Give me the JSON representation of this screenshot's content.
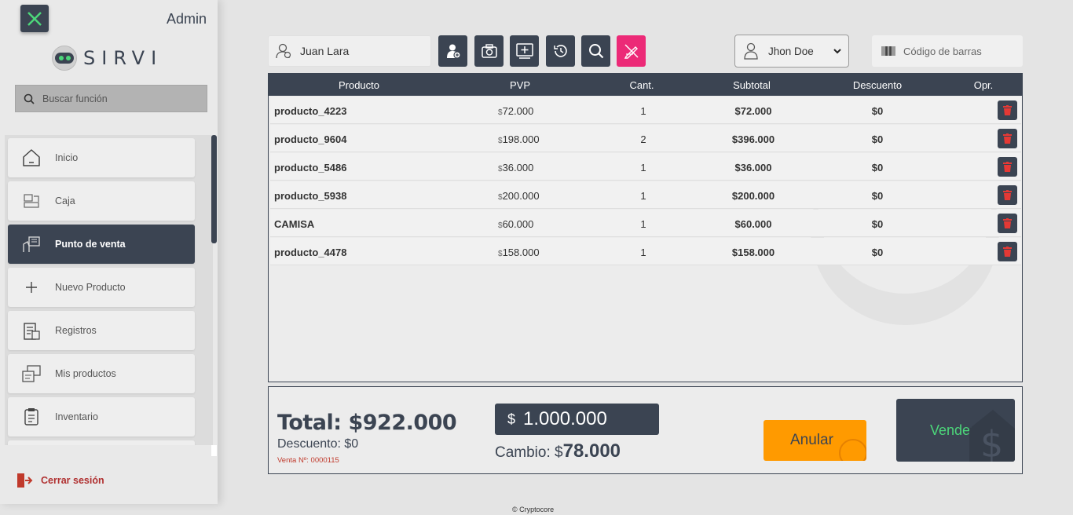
{
  "sidebar": {
    "admin_label": "Admin",
    "logo_text": "SIRVI",
    "search_placeholder": "Buscar función",
    "items": [
      {
        "label": "Inicio",
        "icon": "home-icon"
      },
      {
        "label": "Caja",
        "icon": "cash-register-icon"
      },
      {
        "label": "Punto de venta",
        "icon": "point-of-sale-icon",
        "active": true
      },
      {
        "label": "Nuevo Producto",
        "icon": "plus-icon"
      },
      {
        "label": "Registros",
        "icon": "records-icon"
      },
      {
        "label": "Mis productos",
        "icon": "products-icon"
      },
      {
        "label": "Inventario",
        "icon": "clipboard-icon"
      }
    ],
    "logout_label": "Cerrar sesión"
  },
  "toolbar": {
    "client_value": "Juan Lara",
    "buttons": [
      "add-client-icon",
      "camera-icon",
      "add-window-icon",
      "history-icon",
      "search-icon",
      "pen-off-icon"
    ],
    "seller_value": "Jhon Doe",
    "barcode_placeholder": "Código de barras"
  },
  "table": {
    "headers": [
      "Producto",
      "PVP",
      "Cant.",
      "Subtotal",
      "Descuento",
      "Opr."
    ],
    "rows": [
      {
        "producto": "producto_4223",
        "pvp": "72.000",
        "cant": "1",
        "subtotal": "$72.000",
        "descuento": "$0"
      },
      {
        "producto": "producto_9604",
        "pvp": "198.000",
        "cant": "2",
        "subtotal": "$396.000",
        "descuento": "$0"
      },
      {
        "producto": "producto_5486",
        "pvp": "36.000",
        "cant": "1",
        "subtotal": "$36.000",
        "descuento": "$0"
      },
      {
        "producto": "producto_5938",
        "pvp": "200.000",
        "cant": "1",
        "subtotal": "$200.000",
        "descuento": "$0"
      },
      {
        "producto": "CAMISA",
        "pvp": "60.000",
        "cant": "1",
        "subtotal": "$60.000",
        "descuento": "$0"
      },
      {
        "producto": "producto_4478",
        "pvp": "158.000",
        "cant": "1",
        "subtotal": "$158.000",
        "descuento": "$0"
      }
    ],
    "currency_symbol": "$"
  },
  "summary": {
    "total_label": "Total: $922.000",
    "descuento_label": "Descuento: $0",
    "venta_no": "Venta Nº: 0000115",
    "cash_symbol": "$",
    "cash_amount": "1.000.000",
    "cambio_label": "Cambio: $",
    "cambio_value": "78.000",
    "anular_label": "Anular",
    "vender_label": "Vender"
  },
  "footer": {
    "copyright": "© Cryptocore"
  },
  "colors": {
    "primary": "#3b4452",
    "accent_pink": "#ec2a77",
    "orange": "#ff9a00",
    "green": "#4cd67a"
  }
}
